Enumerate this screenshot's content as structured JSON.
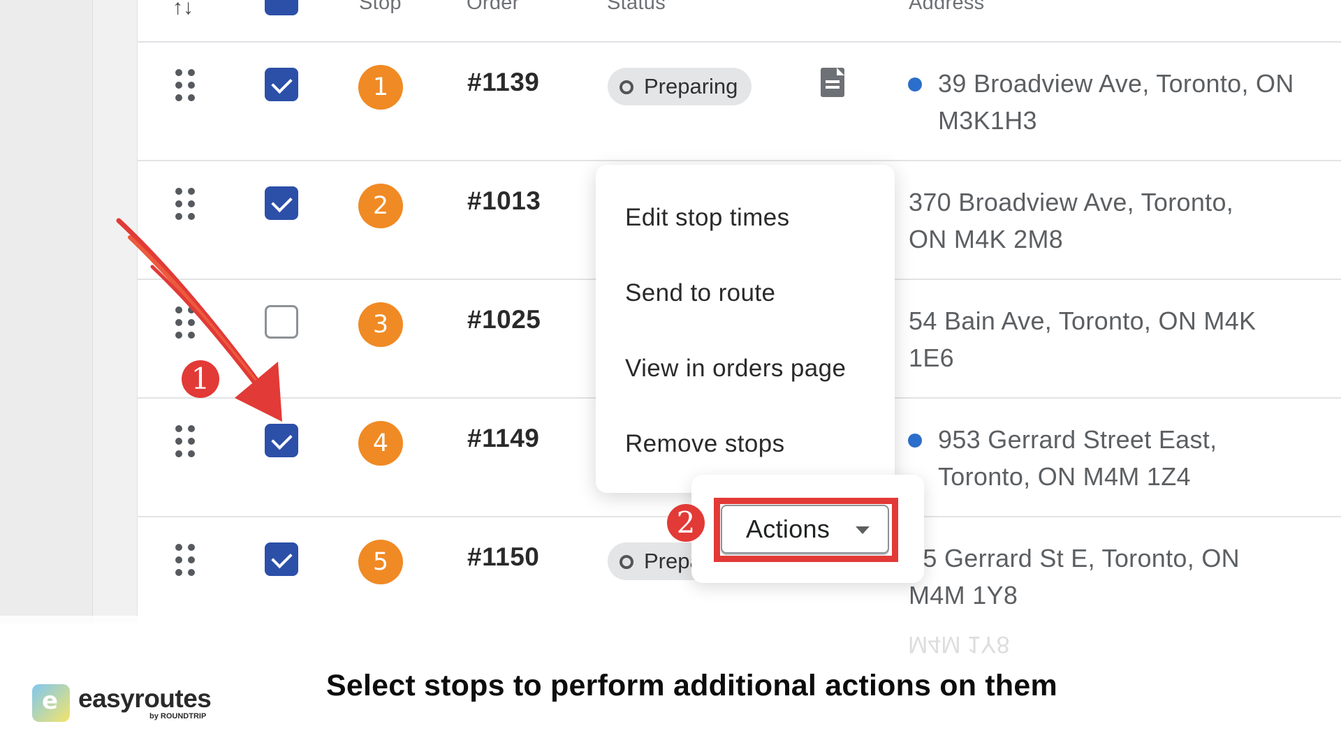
{
  "table": {
    "headers": {
      "stop": "Stop",
      "order": "Order",
      "status": "Status",
      "address": "Address"
    },
    "rows": [
      {
        "stop": "1",
        "order": "#1139",
        "status": "Preparing",
        "selected": true,
        "address": "39 Broadview Ave, Toronto, ON M3K1H3",
        "address_line1": "39 Broadview Ave, Toronto, ON",
        "address_line2": "M3K1H3"
      },
      {
        "stop": "2",
        "order": "#1013",
        "selected": true,
        "address": "370 Broadview Ave, Toronto, ON M4K 2M8",
        "address_line1": "370 Broadview Ave, Toronto,",
        "address_line2": "ON M4K 2M8"
      },
      {
        "stop": "3",
        "order": "#1025",
        "selected": false,
        "address": "54 Bain Ave, Toronto, ON M4K 1E6",
        "address_line1": "54 Bain Ave, Toronto, ON M4K",
        "address_line2": "1E6"
      },
      {
        "stop": "4",
        "order": "#1149",
        "selected": true,
        "address": "953 Gerrard Street East, Toronto, ON M4M 1Z4",
        "address_line1": "953 Gerrard Street East,",
        "address_line2": "Toronto, ON M4M 1Z4"
      },
      {
        "stop": "5",
        "order": "#1150",
        "status": "Prepa",
        "selected": true,
        "address": "55 Gerrard St E, Toronto, ON M4M 1Y8",
        "address_line1": "55 Gerrard St E, Toronto, ON",
        "address_line2": "M4M 1Y8"
      }
    ]
  },
  "actions_menu": {
    "items": [
      "Edit stop times",
      "Send to route",
      "View in orders page",
      "Remove stops"
    ],
    "button_label": "Actions"
  },
  "annotations": {
    "marker_1": "1",
    "marker_2": "2",
    "reflection_text": "M4M 1Y8"
  },
  "caption": "Select stops to perform additional actions on them",
  "brand": {
    "name": "easyroutes",
    "byline": "by ROUNDTRIP",
    "accent": "#e23a36",
    "checkbox_color": "#2c4fa8",
    "stop_color": "#f08a24"
  }
}
